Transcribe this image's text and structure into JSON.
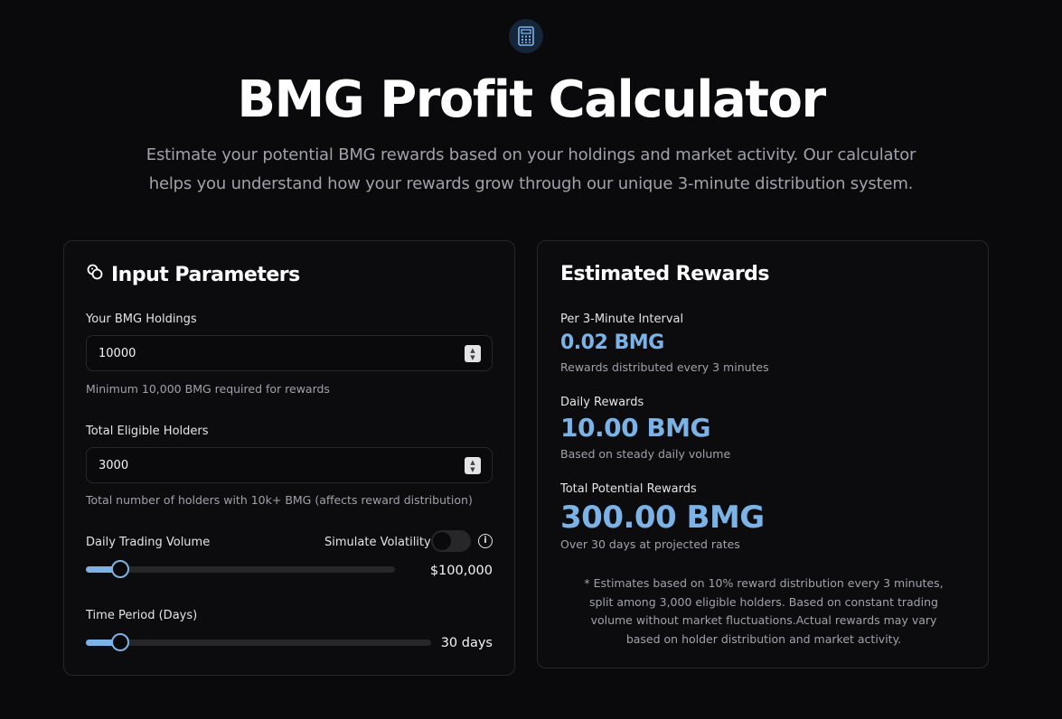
{
  "header": {
    "icon": "calculator-icon",
    "title": "BMG Profit Calculator",
    "subtitle": "Estimate your potential BMG rewards based on your holdings and market activity. Our calculator helps you understand how your rewards grow through our unique 3-minute distribution system."
  },
  "inputs": {
    "title": "Input Parameters",
    "title_icon": "coins-icon",
    "holdings": {
      "label": "Your BMG Holdings",
      "value": "10000",
      "hint": "Minimum 10,000 BMG required for rewards"
    },
    "holders": {
      "label": "Total Eligible Holders",
      "value": "3000",
      "hint": "Total number of holders with 10k+ BMG (affects reward distribution)"
    },
    "volume": {
      "label": "Daily Trading Volume",
      "toggle_label": "Simulate Volatility",
      "toggle_on": false,
      "value_text": "$100,000",
      "slider_fraction": 0.11
    },
    "period": {
      "label": "Time Period (Days)",
      "value_text": "30 days",
      "slider_fraction": 0.1
    }
  },
  "rewards": {
    "title": "Estimated Rewards",
    "interval": {
      "label": "Per 3-Minute Interval",
      "value": "0.02 BMG",
      "sub": "Rewards distributed every 3 minutes"
    },
    "daily": {
      "label": "Daily Rewards",
      "value": "10.00 BMG",
      "sub": "Based on steady daily volume"
    },
    "total": {
      "label": "Total Potential Rewards",
      "value": "300.00 BMG",
      "sub": "Over 30 days at projected rates"
    },
    "note": "* Estimates based on 10% reward distribution every 3 minutes, split among 3,000 eligible holders. Based on constant trading volume without market fluctuations.Actual rewards may vary based on holder distribution and market activity."
  },
  "colors": {
    "accent": "#7cb3e6",
    "background": "#0a0a0c",
    "border": "#27272a"
  }
}
